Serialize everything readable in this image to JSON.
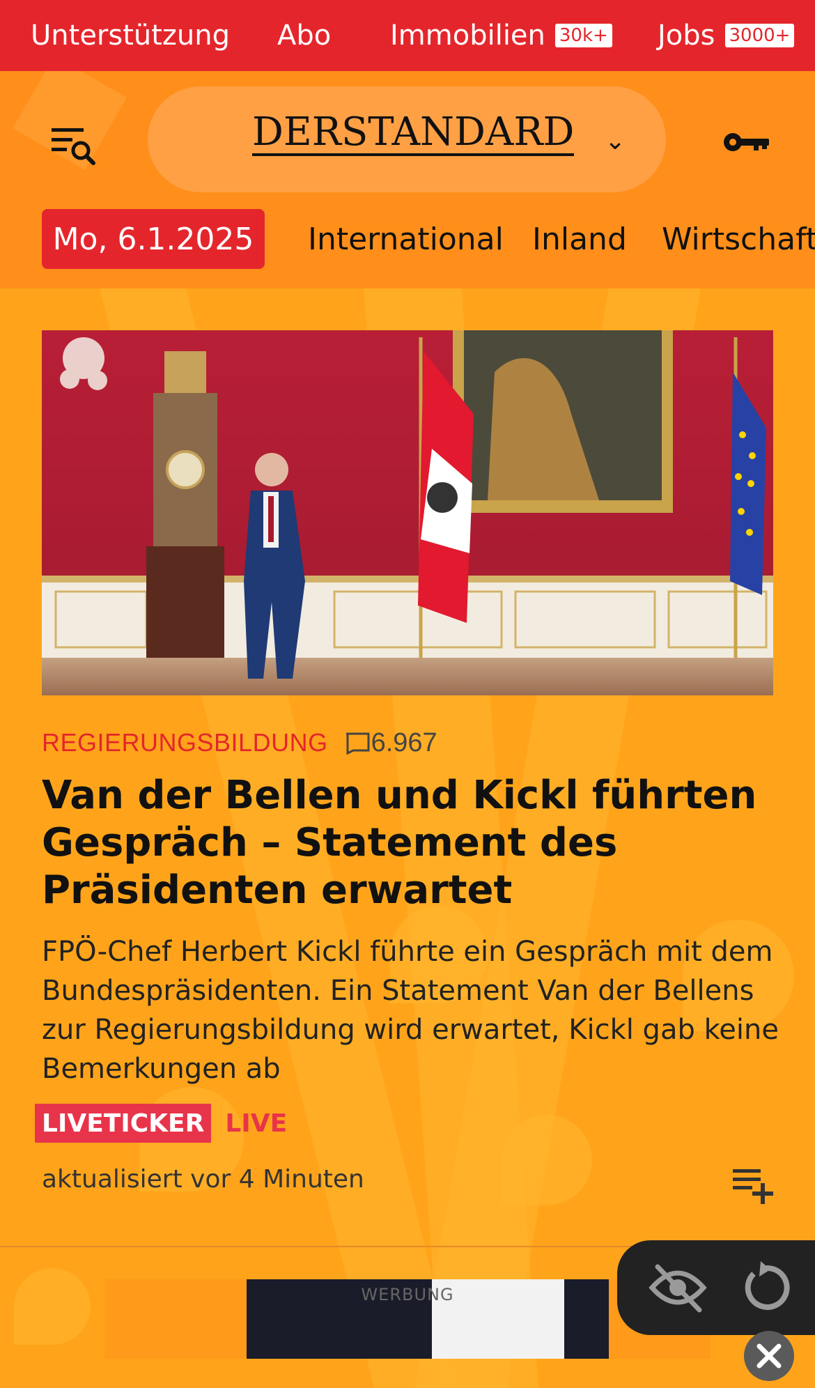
{
  "topbar": {
    "links": [
      {
        "label": "Unterstützung"
      },
      {
        "label": "Abo"
      },
      {
        "label": "Immobilien",
        "badge": "30k+"
      },
      {
        "label": "Jobs",
        "badge": "3000+"
      }
    ]
  },
  "header": {
    "logo_text": "DERSTANDARD",
    "logo_chevron": "⌄",
    "menu_icon": "menu-search-icon",
    "login_icon": "key-icon"
  },
  "nav": {
    "date": "Mo, 6.1.2025",
    "tabs": [
      "International",
      "Inland",
      "Wirtschaft"
    ]
  },
  "article": {
    "kicker": "REGIERUNGSBILDUNG",
    "comment_count": "6.967",
    "headline": "Van der Bellen und Kickl führten Gespräch – Statement des Präsidenten erwartet",
    "teaser": "FPÖ-Chef Herbert Kickl führte ein Gespräch mit dem Bundespräsidenten. Ein Statement Van der Bellens zur Regierungsbildung wird erwartet, Kickl gab keine Bemerkungen ab",
    "badge_liveticker": "LIVETICKER",
    "badge_live": "LIVE",
    "updated": "aktualisiert vor 4 Minuten"
  },
  "ad": {
    "label": "WERBUNG"
  },
  "colors": {
    "brand_red": "#e4262c",
    "background_orange": "#ffa41a",
    "header_orange": "#ff8f1a",
    "live_red": "#e8344a"
  }
}
